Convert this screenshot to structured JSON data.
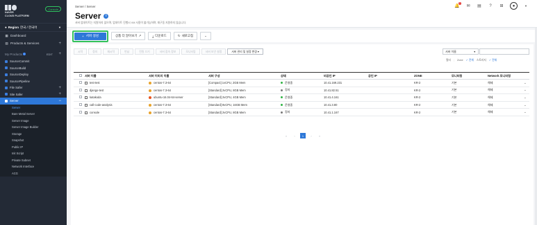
{
  "brand": {
    "line1": "NAVER",
    "line2": "CLOUD PLATFORM",
    "console": "Console"
  },
  "region": {
    "label": "Region",
    "value": "한국 / 한국어"
  },
  "nav": [
    {
      "label": "Dashboard",
      "icon": "dashboard-icon"
    },
    {
      "label": "Products & Services",
      "icon": "grid-icon"
    }
  ],
  "my_products": {
    "label": "My Products",
    "edit": "EDIT"
  },
  "products": [
    {
      "label": "SourceCommit",
      "plus": false
    },
    {
      "label": "SourceBuild",
      "plus": false
    },
    {
      "label": "SourceDeploy",
      "plus": false
    },
    {
      "label": "SourcePipeline",
      "plus": false
    },
    {
      "label": "File Safer",
      "plus": true
    },
    {
      "label": "Site Safer",
      "plus": true
    }
  ],
  "server_item": {
    "label": "Server"
  },
  "server_submenu": [
    "Server",
    "Bare Metal Server",
    "Server Image",
    "Server Image Builder",
    "Storage",
    "Snapshot",
    "Public IP",
    "Init Script",
    "Private Subnet",
    "Network Interface",
    "ACG"
  ],
  "header": {
    "breadcrumb": "Server / Server",
    "title": "Server",
    "description": "서버 업데이트는 지원하지 않으며, 업데이트 진행시 VM 사용이 불가능하며, 재구동 지원하지 않습니다.",
    "notification_count": "1"
  },
  "actions": {
    "create": "서버 생성",
    "more_products": "상품 더 알아보기",
    "download": "다운로드",
    "refresh": "새로고침"
  },
  "ops": [
    "시작",
    "정지",
    "재시작",
    "반납",
    "전원 끄기",
    "서버 접속 정보",
    "모니터링",
    "서버 보안 설정",
    "서버 관리 및 설정 변경"
  ],
  "search": {
    "select": "서버 이름",
    "placeholder": ""
  },
  "filter": {
    "label": "필터",
    "zone": "Zone",
    "all1": "전체",
    "storage": "스토리지",
    "all2": "전체"
  },
  "table": {
    "columns": [
      "서버 이름",
      "서버 이미지 이름",
      "서버 구성",
      "상태",
      "비공인 IP",
      "공인 IP",
      "ZONE",
      "모니터링",
      "Network 모니터링"
    ],
    "rows": [
      {
        "name": "test-test",
        "image": "centos-7.3-64",
        "os": "centos",
        "spec": "[Compact] 1vCPU, 2GB Mem",
        "status": "운영중",
        "status_color": "#2fb344",
        "private_ip": "10.41.169.231",
        "public_ip": "",
        "zone": "KR-2",
        "monitor": "기본",
        "net_monitor": "해제"
      },
      {
        "name": "django-test",
        "image": "centos-7.3-64",
        "os": "centos",
        "spec": "[Standard] 2vCPU, 8GB Mem",
        "status": "정지",
        "status_color": "#777777",
        "private_ip": "10.41.82.51",
        "public_ip": "",
        "zone": "KR-2",
        "monitor": "기본",
        "net_monitor": "해제"
      },
      {
        "name": "katakoda",
        "image": "ubuntu-16.04-64-server",
        "os": "ubuntu",
        "spec": "[Standard] 2vCPU, 4GB Mem",
        "status": "운영중",
        "status_color": "#2fb344",
        "private_ip": "10.41.4.161",
        "public_ip": "",
        "zone": "KR-2",
        "monitor": "기본",
        "net_monitor": "해제"
      },
      {
        "name": "call-code-analysis",
        "image": "centos-7.3-64",
        "os": "centos",
        "spec": "[Standard] 8vCPU, 16GB Mem",
        "status": "운영중",
        "status_color": "#2fb344",
        "private_ip": "10.41.3.80",
        "public_ip": "",
        "zone": "KR-2",
        "monitor": "기본",
        "net_monitor": "해제"
      },
      {
        "name": "console",
        "image": "centos-7.3-64",
        "os": "centos",
        "spec": "[Standard] 2vCPU, 8GB Mem",
        "status": "정지",
        "status_color": "#777777",
        "private_ip": "10.41.1.167",
        "public_ip": "",
        "zone": "KR-2",
        "monitor": "기본",
        "net_monitor": "해제"
      }
    ]
  },
  "pager": {
    "first": "«",
    "prev": "‹",
    "current": "1",
    "next": "›",
    "last": "»"
  }
}
